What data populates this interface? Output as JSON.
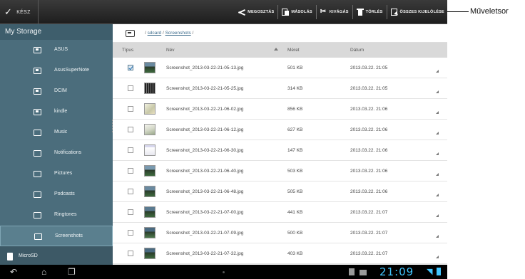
{
  "actionbar": {
    "done_label": "KÉSZ",
    "actions": [
      {
        "label": "MEGOSZTÁS",
        "icon": "share-icon"
      },
      {
        "label": "MÁSOLÁS",
        "icon": "copy-icon"
      },
      {
        "label": "KIVÁGÁS",
        "icon": "cut-icon"
      },
      {
        "label": "TÖRLÉS",
        "icon": "trash-icon"
      },
      {
        "label": "ÖSSZES KIJELÖLÉSE",
        "icon": "select-all-icon"
      }
    ]
  },
  "callout": "Műveletsor",
  "sidebar": {
    "title": "My Storage",
    "items": [
      {
        "label": "ASUS",
        "icon": "usb-folder-icon"
      },
      {
        "label": "AsusSuperNote",
        "icon": "usb-folder-icon"
      },
      {
        "label": "DCIM",
        "icon": "usb-folder-icon"
      },
      {
        "label": "kindle",
        "icon": "usb-folder-icon"
      },
      {
        "label": "Music",
        "icon": "folder-icon"
      },
      {
        "label": "Notifications",
        "icon": "folder-icon"
      },
      {
        "label": "Pictures",
        "icon": "folder-icon"
      },
      {
        "label": "Podcasts",
        "icon": "folder-icon"
      },
      {
        "label": "Ringtones",
        "icon": "folder-icon"
      },
      {
        "label": "Screenshots",
        "icon": "folder-icon"
      }
    ],
    "microsd": "MicroSD"
  },
  "path": {
    "root": "/ ",
    "sdcard": "sdcard",
    "sep": " / ",
    "folder": "Screenshots",
    "end": " /"
  },
  "table": {
    "headers": {
      "type": "Típus",
      "name": "Név",
      "size": "Méret",
      "date": "Dátum"
    },
    "rows": [
      {
        "name": "Screenshot_2013-03-22-21-05-13.jpg",
        "size": "501 KB",
        "date": "2013.03.22. 21:05",
        "checked": true
      },
      {
        "name": "Screenshot_2013-03-22-21-05-25.jpg",
        "size": "314 KB",
        "date": "2013.03.22. 21:05",
        "checked": false
      },
      {
        "name": "Screenshot_2013-03-22-21-06-02.jpg",
        "size": "856 KB",
        "date": "2013.03.22. 21:06",
        "checked": false
      },
      {
        "name": "Screenshot_2013-03-22-21-06-12.jpg",
        "size": "627 KB",
        "date": "2013.03.22. 21:06",
        "checked": false
      },
      {
        "name": "Screenshot_2013-03-22-21-06-30.jpg",
        "size": "147 KB",
        "date": "2013.03.22. 21:06",
        "checked": false
      },
      {
        "name": "Screenshot_2013-03-22-21-06-40.jpg",
        "size": "503 KB",
        "date": "2013.03.22. 21:06",
        "checked": false
      },
      {
        "name": "Screenshot_2013-03-22-21-06-48.jpg",
        "size": "505 KB",
        "date": "2013.03.22. 21:06",
        "checked": false
      },
      {
        "name": "Screenshot_2013-03-22-21-07-00.jpg",
        "size": "441 KB",
        "date": "2013.03.22. 21:07",
        "checked": false
      },
      {
        "name": "Screenshot_2013-03-22-21-07-09.jpg",
        "size": "500 KB",
        "date": "2013.03.22. 21:07",
        "checked": false
      },
      {
        "name": "Screenshot_2013-03-22-21-07-32.jpg",
        "size": "403 KB",
        "date": "2013.03.22. 21:07",
        "checked": false
      }
    ]
  },
  "statusbar": {
    "time": "21:09"
  },
  "colors": {
    "accent": "#42c6ff",
    "sidebar": "#4b6d7c",
    "actionbar": "#2b2b2b"
  }
}
